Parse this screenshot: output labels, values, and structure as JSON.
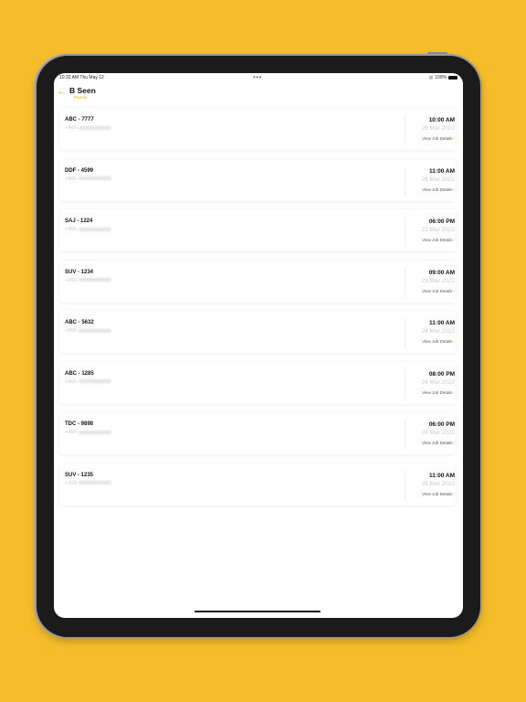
{
  "status_bar": {
    "time": "10:32 AM  Thu May 12",
    "dots": "•••",
    "battery": "100%"
  },
  "header": {
    "title": "B Seen",
    "subtitle": "Partner"
  },
  "jobs": [
    {
      "plate": "ABC - 7777",
      "phone_prefix": "+966-",
      "time": "10:00 AM",
      "date": "26 Mar 2022",
      "link": "View Job Details"
    },
    {
      "plate": "DDF - 4599",
      "phone_prefix": "+966-",
      "time": "11:00 AM",
      "date": "26 Mar 2022",
      "link": "View Job Details"
    },
    {
      "plate": "SAJ - 1224",
      "phone_prefix": "+966-",
      "time": "06:00 PM",
      "date": "22 Mar 2022",
      "link": "View Job Details"
    },
    {
      "plate": "SUV - 1234",
      "phone_prefix": "+263-",
      "time": "09:00 AM",
      "date": "23 Mar 2022",
      "link": "View Job Details"
    },
    {
      "plate": "ABC - 5632",
      "phone_prefix": "+966-",
      "time": "11:00 AM",
      "date": "24 Mar 2022",
      "link": "View Job Details"
    },
    {
      "plate": "ABC - 1285",
      "phone_prefix": "+966-",
      "time": "08:00 PM",
      "date": "24 Mar 2022",
      "link": "View Job Details"
    },
    {
      "plate": "TDC - 9898",
      "phone_prefix": "+966-",
      "time": "06:00 PM",
      "date": "24 Mar 2022",
      "link": "View Job Details"
    },
    {
      "plate": "SUV - 1235",
      "phone_prefix": "+263-",
      "time": "11:00 AM",
      "date": "25 Mar 2022",
      "link": "View Job Details"
    }
  ],
  "icons": {
    "back": "arrow-left-icon",
    "wifi": "wifi-icon",
    "battery": "battery-icon",
    "link_arrow": "chevron-right-icon"
  },
  "colors": {
    "background": "#f6bd2b",
    "accent": "#f0b400"
  }
}
